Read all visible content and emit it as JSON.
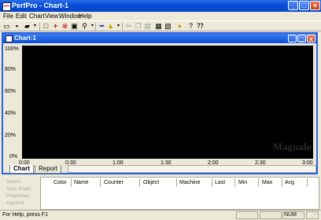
{
  "app": {
    "title": "PerfPro - Chart-1"
  },
  "menu": [
    "File",
    "Edit",
    "Chart",
    "View",
    "Window",
    "Help"
  ],
  "child": {
    "title": "Chart-1"
  },
  "chart": {
    "y_ticks": [
      "100%",
      "80%",
      "60%",
      "40%",
      "20%",
      "0%"
    ],
    "x_ticks": [
      "0:00",
      "0:30",
      "1:00",
      "1:30",
      "2:00",
      "2:30",
      "3:00"
    ],
    "watermark": "Magnalo"
  },
  "tabs": [
    "Chart",
    "Report"
  ],
  "side_panel": [
    "Select",
    "Auto Scale",
    "Properties",
    "Append"
  ],
  "table": {
    "columns": [
      "Color",
      "Name",
      "Counter",
      "Object",
      "Machine",
      "Last",
      "Min",
      "Max",
      "Avg"
    ]
  },
  "status": {
    "text": "For Help, press F1",
    "num": "NUM"
  }
}
